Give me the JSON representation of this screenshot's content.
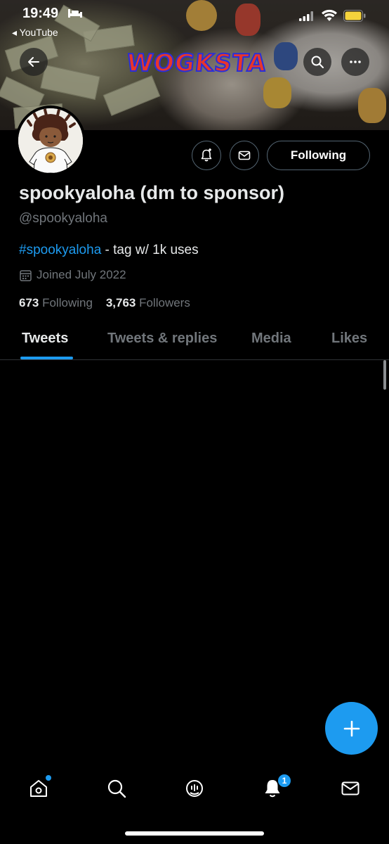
{
  "status_bar": {
    "time": "19:49",
    "back_app": "◂ YouTube"
  },
  "banner": {
    "wordmark": "WOGKSTA"
  },
  "header": {
    "back_icon": "arrow-left-icon",
    "search_icon": "search-icon",
    "more_icon": "more-horizontal-icon"
  },
  "profile": {
    "display_name": "spookyaloha (dm to sponsor)",
    "handle": "@spookyaloha",
    "bio_hashtag": "#spookyaloha",
    "bio_text": " - tag w/ 1k uses",
    "joined": "Joined July 2022",
    "following_count": "673",
    "following_label": " Following",
    "followers_count": "3,763",
    "followers_label": " Followers",
    "following_button": "Following"
  },
  "tabs": [
    {
      "label": "Tweets",
      "active": true
    },
    {
      "label": "Tweets & replies",
      "active": false
    },
    {
      "label": "Media",
      "active": false
    },
    {
      "label": "Likes",
      "active": false
    }
  ],
  "bottom_nav": {
    "items": [
      "home-icon",
      "search-icon",
      "spaces-icon",
      "notifications-icon",
      "messages-icon"
    ],
    "notifications_badge": "1"
  },
  "colors": {
    "accent": "#1d9bf0",
    "background": "#000000",
    "secondary_text": "#71767b"
  }
}
